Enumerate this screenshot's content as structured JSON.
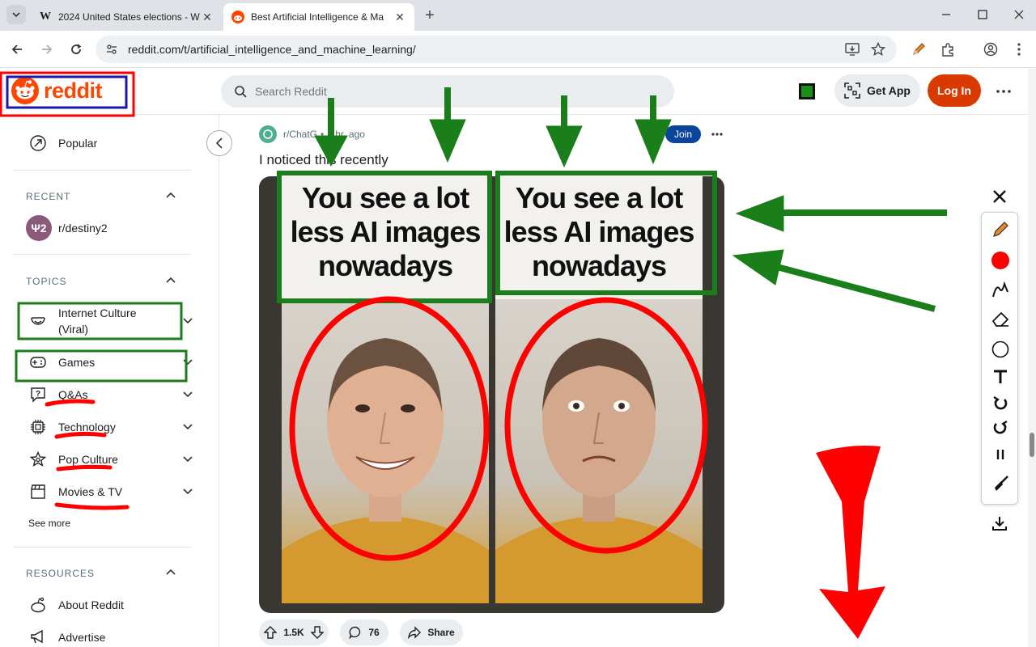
{
  "browser": {
    "tabs": [
      {
        "title": "2024 United States elections - W",
        "favicon": "wikipedia-w-icon"
      },
      {
        "title": "Best Artificial Intelligence & Ma",
        "favicon": "reddit-icon"
      }
    ],
    "url": "reddit.com/t/artificial_intelligence_and_machine_learning/"
  },
  "header": {
    "logo_text": "reddit",
    "search_placeholder": "Search Reddit",
    "get_app_label": "Get App",
    "login_label": "Log In"
  },
  "sidebar": {
    "popular_label": "Popular",
    "recent_heading": "RECENT",
    "recent_items": [
      {
        "label": "r/destiny2"
      }
    ],
    "topics_heading": "TOPICS",
    "topics": [
      {
        "label_line1": "Internet Culture",
        "label_line2": "(Viral)"
      },
      {
        "label": "Games"
      },
      {
        "label": "Q&As"
      },
      {
        "label": "Technology"
      },
      {
        "label": "Pop Culture"
      },
      {
        "label": "Movies & TV"
      }
    ],
    "see_more_label": "See more",
    "resources_heading": "RESOURCES",
    "resources": [
      {
        "label": "About Reddit"
      },
      {
        "label": "Advertise"
      }
    ]
  },
  "post": {
    "subreddit": "r/ChatG",
    "age": "8 hr. ago",
    "join_label": "Join",
    "title": "I noticed this recently",
    "caption_left": [
      "You see a lot",
      "less AI images",
      "nowadays"
    ],
    "caption_right": [
      "You see a lot",
      "less AI images",
      "nowadays"
    ],
    "upvotes": "1.5K",
    "comments": "76",
    "share_label": "Share"
  },
  "colors": {
    "reddit_orange": "#ff4500",
    "login_bg": "#d93a00",
    "join_bg": "#0a449b",
    "annotation_green": "#1a7f1a",
    "annotation_red": "#ff0000"
  }
}
